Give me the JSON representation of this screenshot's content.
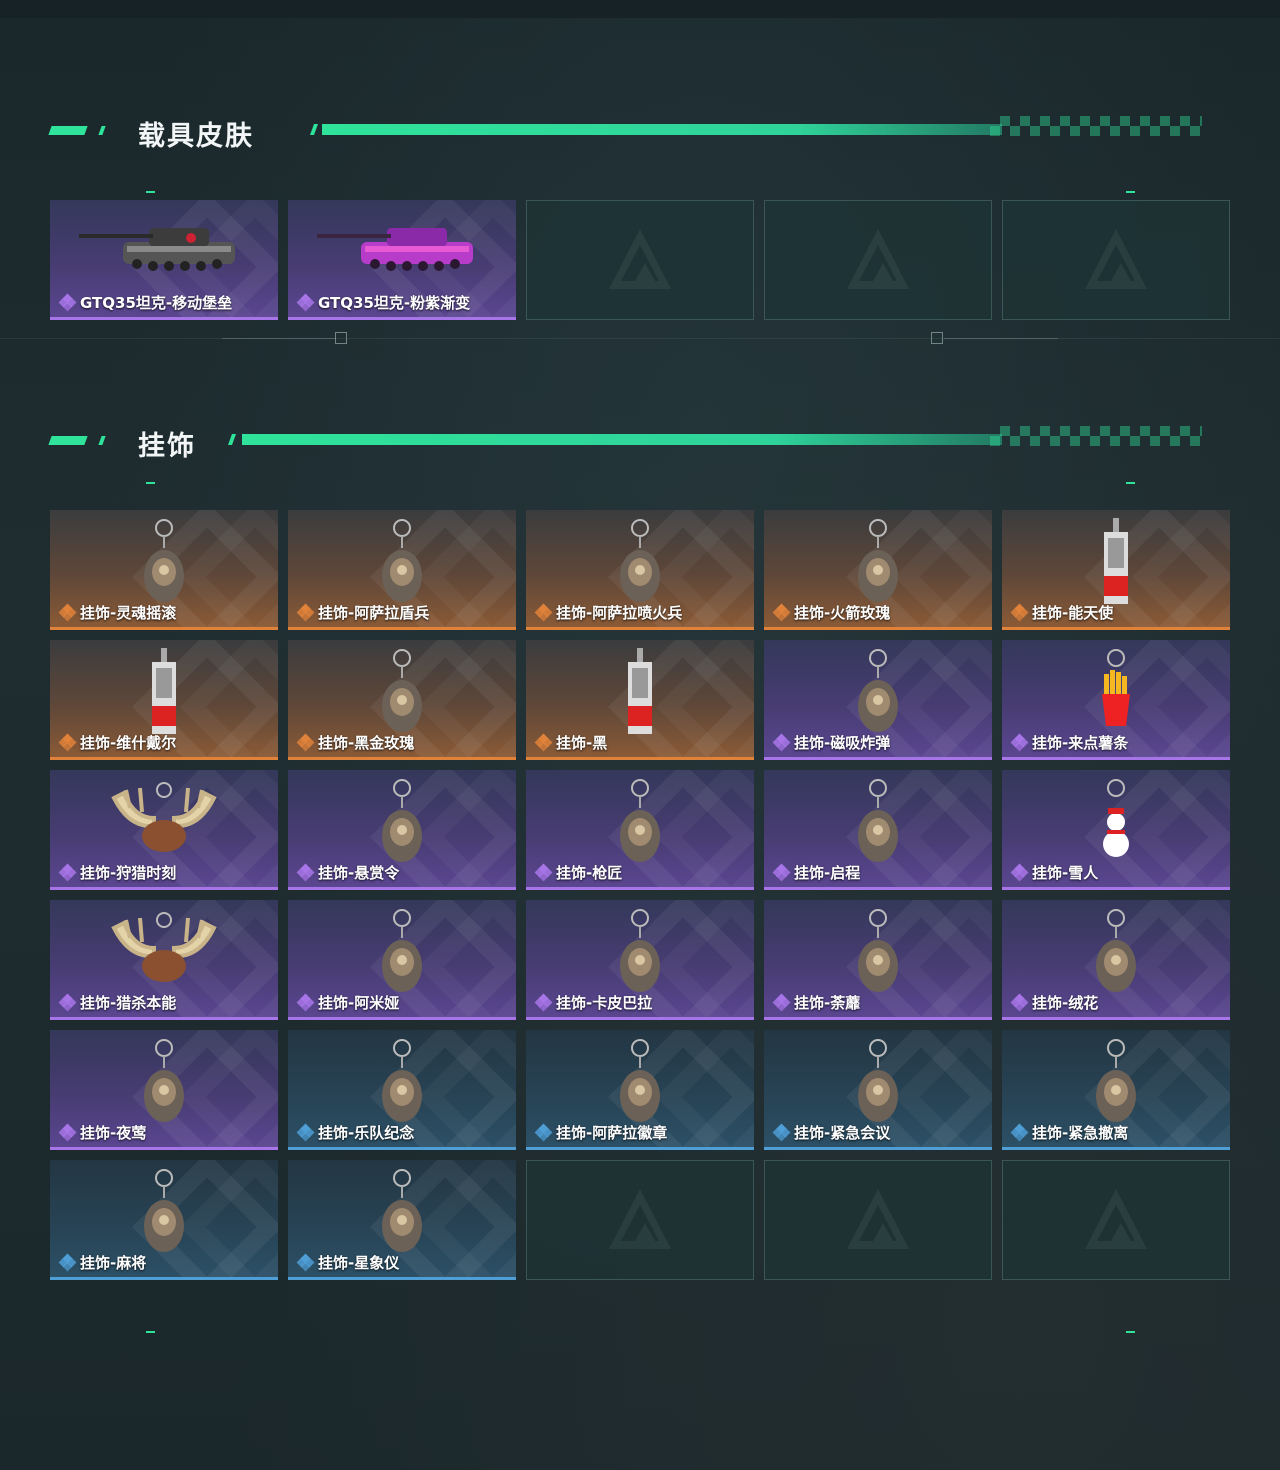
{
  "sections": [
    {
      "title": "载具皮肤",
      "items": [
        {
          "label": "GTQ35坦克-移动堡垒",
          "rarity": "purple",
          "icon": "tank-camo-icon"
        },
        {
          "label": "GTQ35坦克-粉紫渐变",
          "rarity": "purple",
          "icon": "tank-pink-icon"
        },
        {
          "label": "",
          "rarity": "empty",
          "icon": "empty-slot-icon"
        },
        {
          "label": "",
          "rarity": "empty",
          "icon": "empty-slot-icon"
        },
        {
          "label": "",
          "rarity": "empty",
          "icon": "empty-slot-icon"
        }
      ]
    },
    {
      "title": "挂饰",
      "items": [
        {
          "label": "挂饰-灵魂摇滚",
          "rarity": "orange",
          "icon": "guitar-figure-icon"
        },
        {
          "label": "挂饰-阿萨拉盾兵",
          "rarity": "orange",
          "icon": "shield-soldier-icon"
        },
        {
          "label": "挂饰-阿萨拉喷火兵",
          "rarity": "orange",
          "icon": "flamethrower-soldier-icon"
        },
        {
          "label": "挂饰-火箭玫瑰",
          "rarity": "orange",
          "icon": "rocket-rose-icon"
        },
        {
          "label": "挂饰-能天使",
          "rarity": "orange",
          "icon": "card-tag-icon"
        },
        {
          "label": "挂饰-维什戴尔",
          "rarity": "orange",
          "icon": "card-tag-icon"
        },
        {
          "label": "挂饰-黑金玫瑰",
          "rarity": "orange",
          "icon": "black-rose-icon"
        },
        {
          "label": "挂饰-黑",
          "rarity": "orange",
          "icon": "card-tag-icon"
        },
        {
          "label": "挂饰-磁吸炸弹",
          "rarity": "purple",
          "icon": "bomb-icon"
        },
        {
          "label": "挂饰-来点薯条",
          "rarity": "purple",
          "icon": "fries-icon"
        },
        {
          "label": "挂饰-狩猎时刻",
          "rarity": "purple",
          "icon": "antlers-icon"
        },
        {
          "label": "挂饰-悬赏令",
          "rarity": "purple",
          "icon": "scroll-icon"
        },
        {
          "label": "挂饰-枪匠",
          "rarity": "purple",
          "icon": "vest-icon"
        },
        {
          "label": "挂饰-启程",
          "rarity": "purple",
          "icon": "medal-icon"
        },
        {
          "label": "挂饰-雪人",
          "rarity": "purple",
          "icon": "snowman-icon"
        },
        {
          "label": "挂饰-猎杀本能",
          "rarity": "purple",
          "icon": "antlers-icon"
        },
        {
          "label": "挂饰-阿米娅",
          "rarity": "purple",
          "icon": "bunny-icon"
        },
        {
          "label": "挂饰-卡皮巴拉",
          "rarity": "purple",
          "icon": "capybara-icon"
        },
        {
          "label": "挂饰-荼蘼",
          "rarity": "purple",
          "icon": "flower-white-icon"
        },
        {
          "label": "挂饰-绒花",
          "rarity": "purple",
          "icon": "red-flower-icon"
        },
        {
          "label": "挂饰-夜莺",
          "rarity": "purple",
          "icon": "feather-icon"
        },
        {
          "label": "挂饰-乐队纪念",
          "rarity": "blue",
          "icon": "badge-round-icon"
        },
        {
          "label": "挂饰-阿萨拉徽章",
          "rarity": "blue",
          "icon": "emblem-icon"
        },
        {
          "label": "挂饰-紧急会议",
          "rarity": "blue",
          "icon": "meeting-badge-icon"
        },
        {
          "label": "挂饰-紧急撤离",
          "rarity": "blue",
          "icon": "evac-badge-icon"
        },
        {
          "label": "挂饰-麻将",
          "rarity": "blue",
          "icon": "mahjong-icon"
        },
        {
          "label": "挂饰-星象仪",
          "rarity": "blue",
          "icon": "astrolabe-icon"
        },
        {
          "label": "",
          "rarity": "empty",
          "icon": "empty-slot-icon"
        },
        {
          "label": "",
          "rarity": "empty",
          "icon": "empty-slot-icon"
        },
        {
          "label": "",
          "rarity": "empty",
          "icon": "empty-slot-icon"
        }
      ]
    }
  ],
  "colors": {
    "accent": "#2fe39a",
    "orange": "#e0823a",
    "purple": "#a875e8",
    "blue": "#4f9ed6"
  }
}
